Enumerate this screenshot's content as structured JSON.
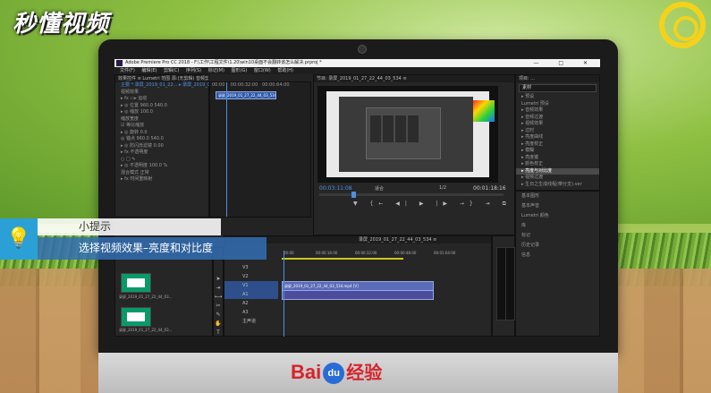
{
  "brand": {
    "top_logo": "秒懂视频",
    "bottom_logo_left": "Bai",
    "bottom_logo_du": "du",
    "bottom_logo_right": "经验"
  },
  "window": {
    "title": "Adobe Premiere Pro CC 2018 - F:\\工作\\工程文件\\1.20\\win10桌面不会翻转该怎么解决.prproj *",
    "controls": "— □ ✕"
  },
  "menu": [
    "文件(F)",
    "编辑(E)",
    "剪辑(C)",
    "序列(S)",
    "标记(M)",
    "图形(G)",
    "窗口(W)",
    "帮助(H)"
  ],
  "effect_controls": {
    "tabs": "效果控件 ≡   Lumetri 范围   源:(无剪辑)   音频剪辑混合器: 录屏_2019_01_27",
    "clip": "主要 * 录屏_2019_01_22...  ▸ 录屏_2019_01_22_...",
    "rows": [
      "视频效果",
      "▸ fx ▭▸ 运动",
      "▸ ◎ 位置  960.0  540.0",
      "▸ ◎ 缩放  100.0",
      "  缩放宽度",
      "  ☑ 等比缩放",
      "▸ ◎ 旋转  0.0",
      "  ◎ 锚点  960.0  540.0",
      "▸ ◎ 防闪烁滤镜  0.00",
      "▸ fx 不透明度",
      "  ○ □ ✎",
      "▸ ◎ 不透明度  100.0 %",
      "  混合模式  正常",
      "▸ fx 时间重映射"
    ],
    "time": "00:03:11:08"
  },
  "source_mini": {
    "times": [
      "00:00",
      "00:00:32:00",
      "00:00:64:00"
    ],
    "clip": "录屏_2019_01_27_22_44_03_534.mp4"
  },
  "program": {
    "tab": "节目: 录屏_2019_01_27_22_44_03_534 ≡",
    "timecode_left": "00:03:11:08",
    "fit": "适合",
    "ratio": "1/2",
    "timecode_right": "00:01:18:16",
    "controls": "▼ {← ◀| ▶ |▶ →} ⇥ ⧉ ◉ +"
  },
  "project": {
    "tab": "项目: ...",
    "search": "素材",
    "items": [
      "▸ 预设",
      "  Lumetri 预设",
      "▸ 音频效果",
      "▸ 音频过渡",
      "▸ 视频效果",
      "  ▸ 过时",
      "    ▸ 亮度曲线",
      "    ▸ 亮度校正",
      "  ▸ 模糊",
      "    ▸ 亮度键",
      "  ▸ 颜色校正",
      "    ▸ 亮度与对比度",
      "▸ 视频过渡",
      "  ▸ 生日之生成线程(带分支).ver"
    ],
    "lower": [
      "基本图形",
      "基本声音",
      "Lumetri 颜色",
      "库",
      "标记",
      "历史记录",
      "信息"
    ]
  },
  "timeline": {
    "tab": "录屏_2019_01_27_22_44_03_534 ≡",
    "time": "00:03:11:08",
    "ruler": [
      "00:00",
      "00:00:16:00",
      "00:00:32:00",
      "00:00:48:00",
      "00:01:04:00"
    ],
    "tracks": [
      "V3",
      "V2",
      "V1",
      "A1",
      "A2",
      "A3",
      "主声道"
    ],
    "clip_v": "录屏_2019_01_27_22_44_03_534.mp4 [V]",
    "clip_a": ""
  },
  "project_thumbs": {
    "label1": "录屏_2019_01_27_22_44_03...",
    "label2": "录屏_2019_01_27_22_44_03..."
  },
  "tip": {
    "title": "小提示",
    "text": "选择视频效果–亮度和对比度"
  },
  "colors": {
    "accent": "#2ba0d6",
    "premiere_blue": "#4c8fe0",
    "baidu_red": "#d8232a",
    "baidu_blue": "#2a6bd6"
  }
}
